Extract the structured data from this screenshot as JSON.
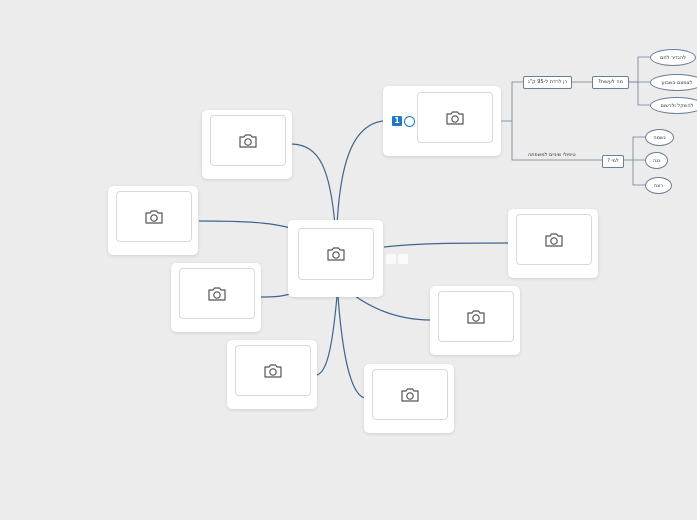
{
  "mindmap": {
    "central": {
      "icon": "camera-icon"
    },
    "image_nodes": [
      {
        "id": "top-right",
        "icon": "camera-icon",
        "badges": {
          "number": "1",
          "clock": "clock-icon"
        }
      },
      {
        "id": "top-left",
        "icon": "camera-icon"
      },
      {
        "id": "left-upper",
        "icon": "camera-icon"
      },
      {
        "id": "left-middle",
        "icon": "camera-icon"
      },
      {
        "id": "bottom-left",
        "icon": "camera-icon"
      },
      {
        "id": "bottom-center",
        "icon": "camera-icon"
      },
      {
        "id": "right-lower",
        "icon": "camera-icon"
      },
      {
        "id": "right",
        "icon": "camera-icon"
      }
    ],
    "text_branch": {
      "level1_a": "רן לרדת ל-95 ק\"ג",
      "level2_a": "?מה לעשות",
      "level3_a": [
        "להגדיר לחם",
        "לצמצם בשבוע",
        "להשקל ולרשום"
      ],
      "level1_b": "טיפולי שיניים למשפחה",
      "level2_b": "? למי",
      "level3_b": [
        "נשמה",
        "נגה",
        "רונה"
      ]
    }
  }
}
